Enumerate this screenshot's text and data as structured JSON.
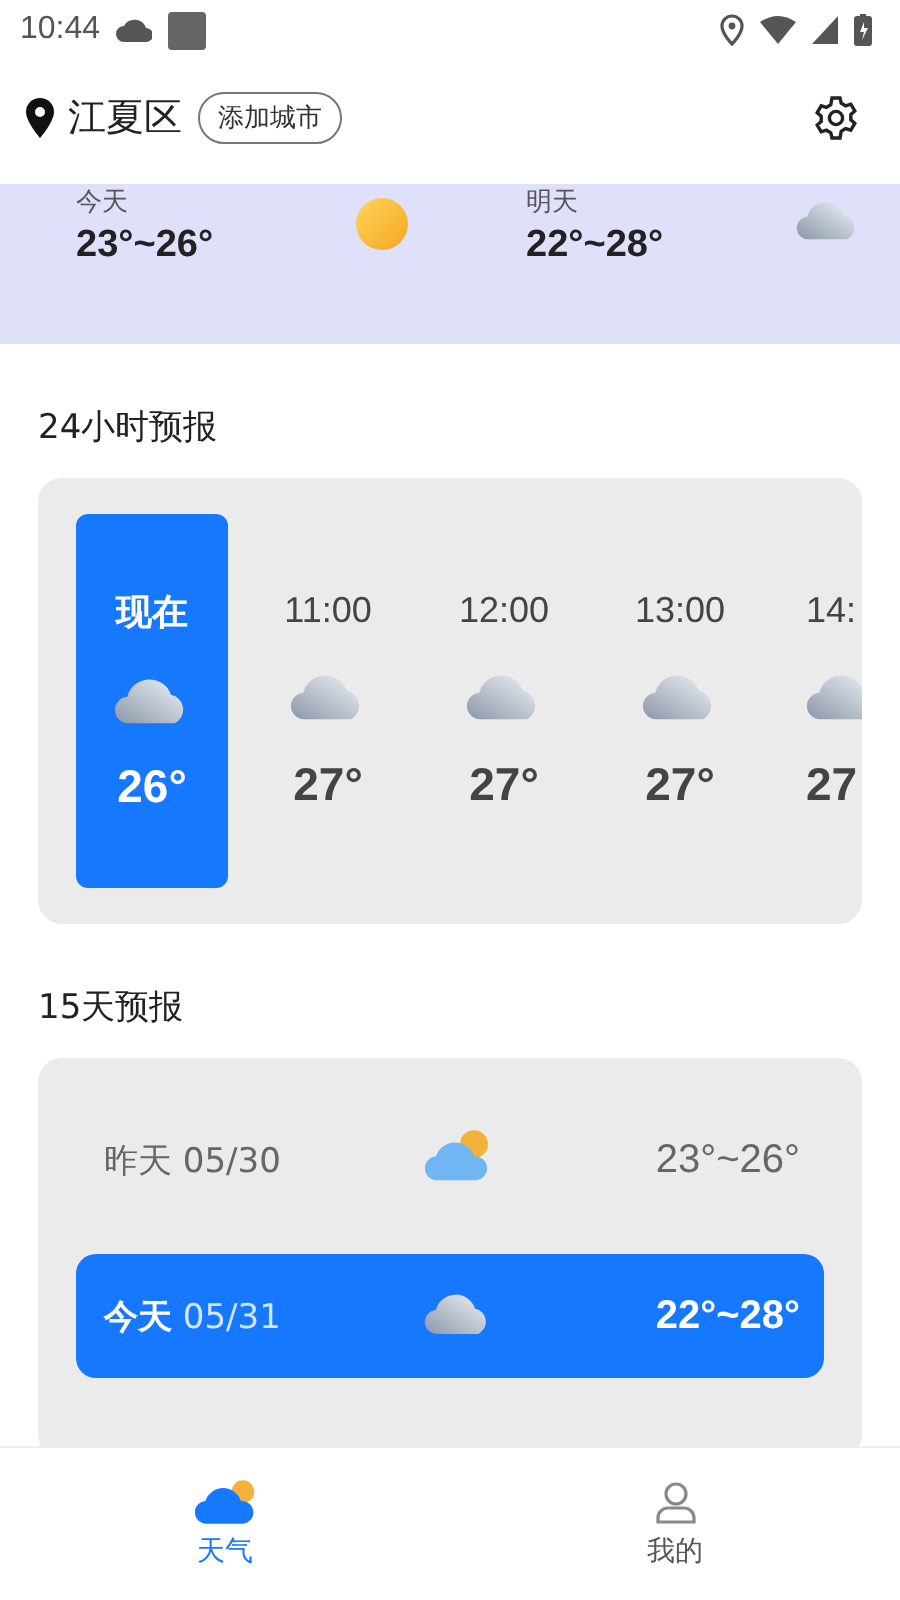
{
  "status_bar": {
    "time": "10:44"
  },
  "header": {
    "location": "江夏区",
    "add_city_button": "添加城市"
  },
  "banner": {
    "days": [
      {
        "label": "今天",
        "range": "23°~26°",
        "kind": "sunny"
      },
      {
        "label": "明天",
        "range": "22°~28°",
        "kind": "cloudy"
      }
    ]
  },
  "hourly": {
    "title": "24小时预报",
    "hours": [
      {
        "time": "现在",
        "kind": "cloudy",
        "temp": "26°",
        "selected": true
      },
      {
        "time": "11:00",
        "kind": "cloudy",
        "temp": "27°",
        "selected": false
      },
      {
        "time": "12:00",
        "kind": "cloudy",
        "temp": "27°",
        "selected": false
      },
      {
        "time": "13:00",
        "kind": "cloudy",
        "temp": "27°",
        "selected": false
      },
      {
        "time": "14:",
        "kind": "cloudy",
        "temp": "27",
        "selected": false
      }
    ]
  },
  "daily": {
    "title": "15天预报",
    "days": [
      {
        "day": "昨天",
        "date": "05/30",
        "kind": "partly_cloudy",
        "range": "23°~26°",
        "selected": false
      },
      {
        "day": "今天",
        "date": "05/31",
        "kind": "cloudy",
        "range": "22°~28°",
        "selected": true
      }
    ]
  },
  "tab_bar": [
    {
      "label": "天气",
      "kind": "weather",
      "selected": true
    },
    {
      "label": "我的",
      "kind": "person",
      "selected": false
    }
  ]
}
